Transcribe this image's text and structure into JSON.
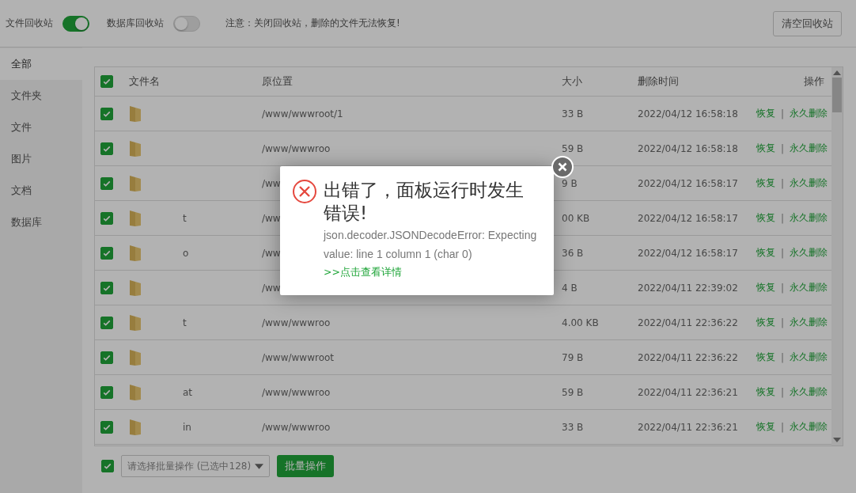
{
  "top_bar": {
    "toggles": [
      {
        "label": "文件回收站",
        "on": true
      },
      {
        "label": "数据库回收站",
        "on": false
      }
    ],
    "notice": "注意：关闭回收站，删除的文件无法恢复!",
    "clear_button": "清空回收站"
  },
  "sidebar": {
    "items": [
      {
        "label": "全部",
        "selected": true
      },
      {
        "label": "文件夹",
        "selected": false
      },
      {
        "label": "文件",
        "selected": false
      },
      {
        "label": "图片",
        "selected": false
      },
      {
        "label": "文档",
        "selected": false
      },
      {
        "label": "数据库",
        "selected": false
      }
    ]
  },
  "table": {
    "all_checked": true,
    "columns": [
      "文件名",
      "原位置",
      "大小",
      "删除时间",
      "操作"
    ],
    "rows": [
      {
        "checked": true,
        "name": "",
        "path": "/www/wwwroot/1",
        "size": "33 B",
        "time": "2022/04/12 16:58:18",
        "actions": [
          "恢复",
          "|",
          "永久删除"
        ]
      },
      {
        "checked": true,
        "name": "",
        "path": "/www/wwwroo",
        "size": "59 B",
        "time": "2022/04/12 16:58:18",
        "actions": [
          "恢复",
          "|",
          "永久删除"
        ]
      },
      {
        "checked": true,
        "name": "",
        "path": "/ww",
        "size": "9 B",
        "time": "2022/04/12 16:58:17",
        "actions": [
          "恢复",
          "|",
          "永久删除"
        ]
      },
      {
        "checked": true,
        "name": "t",
        "path": "/ww",
        "size": "00 KB",
        "time": "2022/04/12 16:58:17",
        "actions": [
          "恢复",
          "|",
          "永久删除"
        ]
      },
      {
        "checked": true,
        "name": "o",
        "path": "/ww",
        "size": "36 B",
        "time": "2022/04/12 16:58:17",
        "actions": [
          "恢复",
          "|",
          "永久删除"
        ]
      },
      {
        "checked": true,
        "name": "",
        "path": "/ww",
        "size": "4 B",
        "time": "2022/04/11 22:39:02",
        "actions": [
          "恢复",
          "|",
          "永久删除"
        ]
      },
      {
        "checked": true,
        "name": "t",
        "path": "/www/wwwroo",
        "size": "4.00 KB",
        "time": "2022/04/11 22:36:22",
        "actions": [
          "恢复",
          "|",
          "永久删除"
        ]
      },
      {
        "checked": true,
        "name": "",
        "path": "/www/wwwroot",
        "size": "79 B",
        "time": "2022/04/11 22:36:22",
        "actions": [
          "恢复",
          "|",
          "永久删除"
        ]
      },
      {
        "checked": true,
        "name": "at",
        "path": "/www/wwwroo",
        "size": "59 B",
        "time": "2022/04/11 22:36:21",
        "actions": [
          "恢复",
          "|",
          "永久删除"
        ]
      },
      {
        "checked": true,
        "name": "in",
        "path": "/www/wwwroo",
        "size": "33 B",
        "time": "2022/04/11 22:36:21",
        "actions": [
          "恢复",
          "|",
          "永久删除"
        ]
      }
    ]
  },
  "footer": {
    "checked": true,
    "select_placeholder": "请选择批量操作 (已选中128)",
    "batch_button": "批量操作"
  },
  "dialog": {
    "title": "出错了，面板运行时发生错误!",
    "message": "json.decoder.JSONDecodeError: Expecting value: line 1 column 1 (char 0)",
    "link": ">>点击查看详情"
  }
}
